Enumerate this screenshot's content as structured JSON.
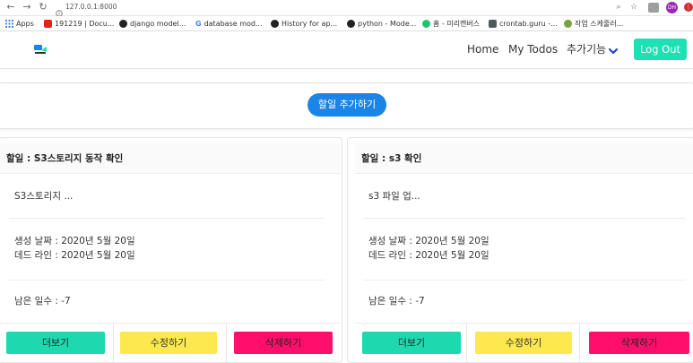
{
  "browser": {
    "url": "127.0.0.1:8000",
    "profile_initials": "DH",
    "bookmarks": [
      {
        "label": "Apps",
        "icon": "apps-grid-icon",
        "color": "#4285f4"
      },
      {
        "label": "191219 | Docu...",
        "icon": "youtube-icon",
        "color": "#e62117"
      },
      {
        "label": "django model...",
        "icon": "circle-icon",
        "color": "#222222"
      },
      {
        "label": "database mod...",
        "icon": "google-icon",
        "color": "#4285f4"
      },
      {
        "label": "History for ap...",
        "icon": "github-icon",
        "color": "#222222"
      },
      {
        "label": "python - Mode...",
        "icon": "circle-icon",
        "color": "#222222"
      },
      {
        "label": "홈 - 미리캔버스",
        "icon": "miricanvas-icon",
        "color": "#21c36f"
      },
      {
        "label": "crontab.guru -...",
        "icon": "crontab-icon",
        "color": "#4e5a5a"
      },
      {
        "label": "작업 스케줄러...",
        "icon": "scheduler-icon",
        "color": "#7aa33f"
      }
    ]
  },
  "navbar": {
    "home": "Home",
    "my_todos": "My Todos",
    "more": "추가기능",
    "logout": "Log Out"
  },
  "add_button": "할일 추가하기",
  "todos": [
    {
      "title": "할일 : S3스토리지 동작 확인",
      "summary": "S3스토리지 ...",
      "created": "생성 날짜 : 2020년 5월 20일",
      "deadline": "데드 라인 : 2020년 5월 20일",
      "days_left": "남은 일수 : -7",
      "more": "더보기",
      "edit": "수정하기",
      "delete": "삭제하기"
    },
    {
      "title": "할일 : s3 확인",
      "summary": "s3 파일 업...",
      "created": "생성 날짜 : 2020년 5월 20일",
      "deadline": "데드 라인 : 2020년 5월 20일",
      "days_left": "남은 일수 : -7",
      "more": "더보기",
      "edit": "수정하기",
      "delete": "삭제하기"
    }
  ],
  "colors": {
    "accent_teal": "#1de0b3",
    "primary_blue": "#1b84e7",
    "edit_yellow": "#fde94e",
    "delete_pink": "#ff0f6b"
  }
}
